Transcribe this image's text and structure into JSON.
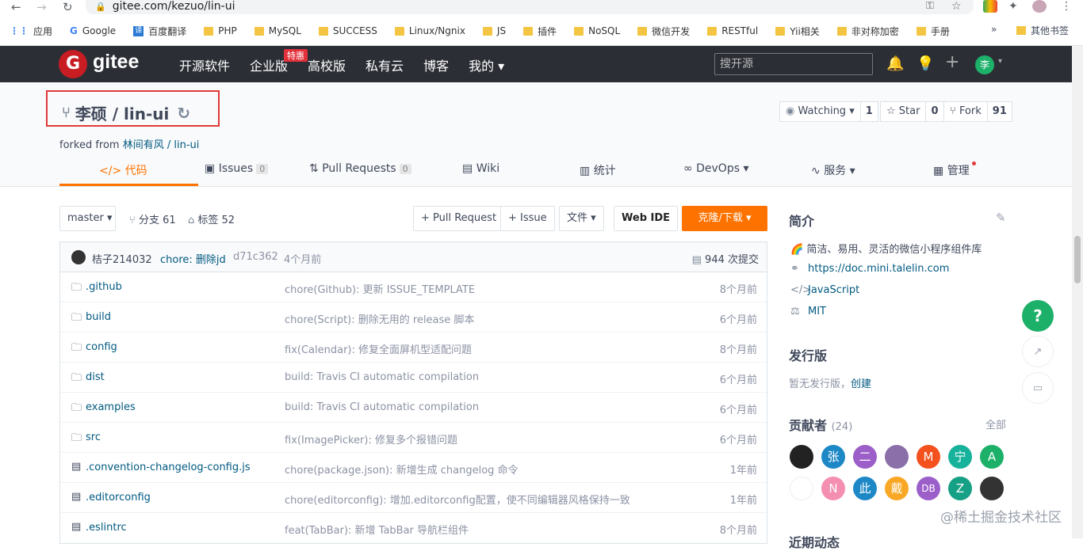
{
  "browser": {
    "url": "gitee.com/kezuo/lin-ui",
    "bookmarks": [
      "应用",
      "Google",
      "百度翻译",
      "PHP",
      "MySQL",
      "SUCCESS",
      "Linux/Ngnix",
      "JS",
      "插件",
      "NoSQL",
      "微信开发",
      "RESTful",
      "Yii相关",
      "非对称加密",
      "手册"
    ],
    "more": "»",
    "other_bookmarks": "其他书签"
  },
  "topbar": {
    "logo_letter": "G",
    "brand": "gitee",
    "nav": [
      "开源软件",
      "企业版",
      "高校版",
      "私有云",
      "博客",
      "我的 ▾"
    ],
    "special_badge": "特惠",
    "search_placeholder": "搜开源",
    "avatar_letter": "李"
  },
  "repo": {
    "title": "李硕 / lin-ui",
    "forked_prefix": "forked from",
    "forked_from": "林间有风 / lin-ui",
    "watching_label": "Watching ▾",
    "watching_count": "1",
    "star_label": "Star",
    "star_count": "0",
    "fork_label": "Fork",
    "fork_count": "91"
  },
  "tabs": [
    {
      "label": "代码",
      "icon": "</>",
      "count": ""
    },
    {
      "label": "Issues",
      "icon": "▣",
      "count": "0"
    },
    {
      "label": "Pull Requests",
      "icon": "⇅",
      "count": "0"
    },
    {
      "label": "Wiki",
      "icon": "▤",
      "count": ""
    },
    {
      "label": "统计",
      "icon": "▥",
      "count": ""
    },
    {
      "label": "DevOps ▾",
      "icon": "∞",
      "count": ""
    },
    {
      "label": "服务 ▾",
      "icon": "∿",
      "count": ""
    },
    {
      "label": "管理",
      "icon": "▦",
      "count": ""
    }
  ],
  "toolbar": {
    "branch": "master ▾",
    "branches": "分支 61",
    "tags": "标签 52",
    "pull_request": "+ Pull Request",
    "issue": "+ Issue",
    "file": "文件 ▾",
    "webide": "Web IDE",
    "clone": "克隆/下载 ▾"
  },
  "commit": {
    "author": "桔子214032",
    "message": "chore: 删除jd",
    "sha": "d71c362",
    "time": "4个月前",
    "total": "944 次提交"
  },
  "files": [
    {
      "type": "folder",
      "name": ".github",
      "msg": "chore(Github): 更新 ISSUE_TEMPLATE",
      "time": "8个月前"
    },
    {
      "type": "folder",
      "name": "build",
      "msg": "chore(Script): 删除无用的 release 脚本",
      "time": "6个月前"
    },
    {
      "type": "folder",
      "name": "config",
      "msg": "fix(Calendar): 修复全面屏机型适配问题",
      "time": "8个月前"
    },
    {
      "type": "folder",
      "name": "dist",
      "msg": "build: Travis CI automatic compilation",
      "time": "6个月前"
    },
    {
      "type": "folder",
      "name": "examples",
      "msg": "build: Travis CI automatic compilation",
      "time": "6个月前"
    },
    {
      "type": "folder",
      "name": "src",
      "msg": "fix(ImagePicker): 修复多个报错问题",
      "time": "6个月前"
    },
    {
      "type": "file",
      "name": ".convention-changelog-config.js",
      "msg": "chore(package.json): 新增生成 changelog 命令",
      "time": "1年前"
    },
    {
      "type": "file",
      "name": ".editorconfig",
      "msg": "chore(editorconfig): 增加.editorconfig配置，使不同编辑器风格保持一致",
      "time": "1年前"
    },
    {
      "type": "file",
      "name": ".eslintrc",
      "msg": "feat(TabBar): 新增 TabBar 导航栏组件",
      "time": "8个月前"
    }
  ],
  "sidebar": {
    "intro_title": "简介",
    "intro_desc": "🌈 简洁、易用、灵活的微信小程序组件库",
    "homepage": "https://doc.mini.talelin.com",
    "language": "JavaScript",
    "license": "MIT",
    "release_title": "发行版",
    "release_text": "暂无发行版，",
    "release_create": "创建",
    "contrib_title": "贡献者",
    "contrib_count": "(24)",
    "contrib_all": "全部",
    "contributors": [
      {
        "letter": "",
        "color": "#222222"
      },
      {
        "letter": "张",
        "color": "#1e88c7"
      },
      {
        "letter": "二",
        "color": "#9c5fc9"
      },
      {
        "letter": "",
        "color": "#8a6fa8"
      },
      {
        "letter": "M",
        "color": "#f4511e"
      },
      {
        "letter": "宁",
        "color": "#16b29b"
      },
      {
        "letter": "A",
        "color": "#1db069"
      },
      {
        "letter": "",
        "color": "#ffffff"
      },
      {
        "letter": "N",
        "color": "#f48fb1"
      },
      {
        "letter": "此",
        "color": "#1e88c7"
      },
      {
        "letter": "戴",
        "color": "#f9a825"
      },
      {
        "letter": "DB",
        "color": "#9c5fc9"
      },
      {
        "letter": "Z",
        "color": "#16a085"
      },
      {
        "letter": "",
        "color": "#333333"
      }
    ],
    "recent_title": "近期动态"
  },
  "floaters": {
    "help": "?"
  },
  "watermark": "@稀土掘金技术社区"
}
